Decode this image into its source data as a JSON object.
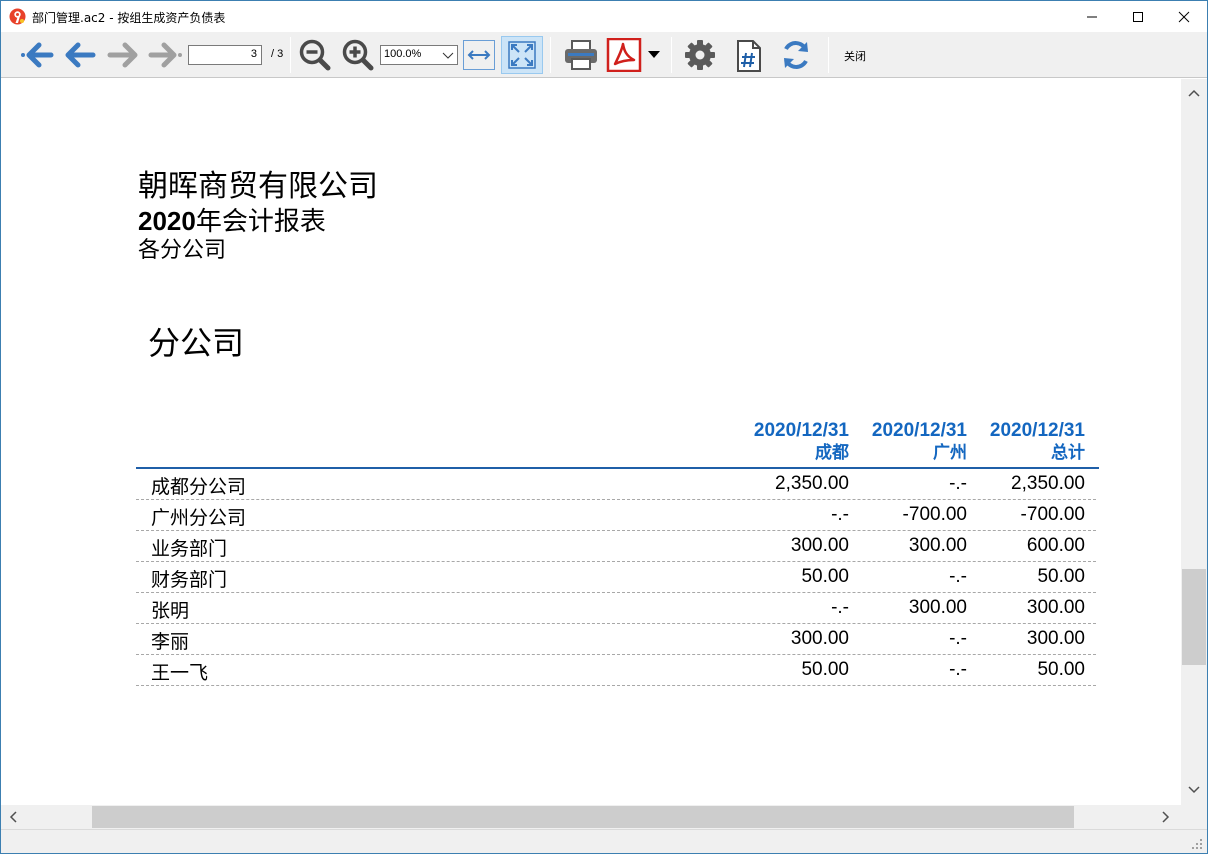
{
  "window": {
    "title": "部门管理.ac2 - 按组生成资产负债表"
  },
  "toolbar": {
    "page_current": "3",
    "page_total": "/ 3",
    "zoom": "100.0%",
    "close_label": "关闭",
    "icons": [
      "first-page-icon",
      "prev-page-icon",
      "next-page-icon",
      "last-page-icon",
      "zoom-out-icon",
      "zoom-in-icon",
      "fit-width-icon",
      "fit-page-icon",
      "print-icon",
      "pdf-icon",
      "settings-icon",
      "page-number-icon",
      "refresh-icon"
    ]
  },
  "report": {
    "company": "朝晖商贸有限公司",
    "year": "2020",
    "title_rest": "年会计报表",
    "subtitle": "各分公司",
    "section": "分公司",
    "columns": [
      {
        "date": "2020/12/31",
        "name": "成都"
      },
      {
        "date": "2020/12/31",
        "name": "广州"
      },
      {
        "date": "2020/12/31",
        "name": "总计"
      }
    ],
    "rows": [
      {
        "label": "成都分公司",
        "values": [
          "2,350.00",
          "-.-",
          "2,350.00"
        ]
      },
      {
        "label": "广州分公司",
        "values": [
          "-.-",
          "-700.00",
          "-700.00"
        ]
      },
      {
        "label": "业务部门",
        "values": [
          "300.00",
          "300.00",
          "600.00"
        ]
      },
      {
        "label": "财务部门",
        "values": [
          "50.00",
          "-.-",
          "50.00"
        ]
      },
      {
        "label": "张明",
        "values": [
          "-.-",
          "300.00",
          "300.00"
        ]
      },
      {
        "label": "李丽",
        "values": [
          "300.00",
          "-.-",
          "300.00"
        ]
      },
      {
        "label": "王一飞",
        "values": [
          "50.00",
          "-.-",
          "50.00"
        ]
      }
    ]
  },
  "colors": {
    "accent": "#1467c0",
    "icon_blue": "#3b7ac1",
    "pdf_red": "#d0201c"
  }
}
